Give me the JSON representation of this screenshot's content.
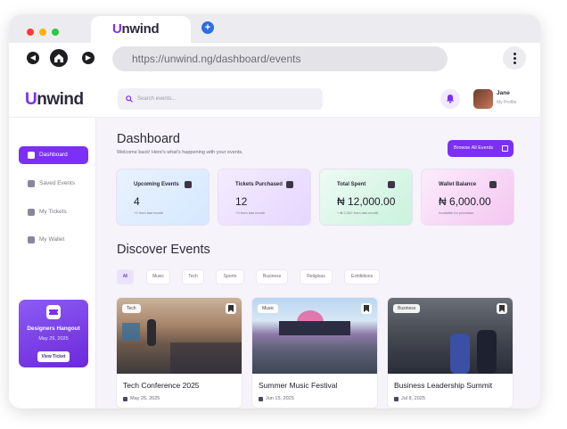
{
  "browser": {
    "tab_logo_u": "U",
    "tab_logo_rest": "nwind",
    "new_tab": "+",
    "url": "https://unwind.ng/dashboard/events"
  },
  "header": {
    "brand_u": "U",
    "brand_rest": "nwind",
    "search_placeholder": "Search events...",
    "user_name": "Jane",
    "user_role": "My Profile"
  },
  "sidebar": {
    "items": [
      {
        "label": "Dashboard",
        "icon": "home-icon"
      },
      {
        "label": "Saved Events",
        "icon": "bookmark-icon"
      },
      {
        "label": "My Tickets",
        "icon": "ticket-icon"
      },
      {
        "label": "My Wallet",
        "icon": "wallet-icon"
      }
    ],
    "promo": {
      "title": "Designers Hangout",
      "date": "May 29, 2025",
      "button": "View Ticket"
    }
  },
  "main": {
    "title": "Dashboard",
    "subtitle": "Welcome back! Here's what's happening with your events.",
    "browse_button": "Browse All Events",
    "stats": [
      {
        "title": "Upcoming Events",
        "value": "4",
        "note": "+2 from last month"
      },
      {
        "title": "Tickets Purchased",
        "value": "12",
        "note": "+3 from last month"
      },
      {
        "title": "Total Spent",
        "value": "₦ 12,000.00",
        "note": "+ ₦ 2,000 from last month"
      },
      {
        "title": "Wallet Balance",
        "value": "₦ 6,000.00",
        "note": "Available for purchase"
      }
    ],
    "discover_title": "Discover Events",
    "filters": [
      "All",
      "Music",
      "Tech",
      "Sports",
      "Business",
      "Religious",
      "Exhibitions"
    ],
    "events": [
      {
        "tag": "Tech",
        "title": "Tech Conference 2025",
        "date": "May 25, 2025"
      },
      {
        "tag": "Music",
        "title": "Summer Music Festival",
        "date": "Jun 15, 2025"
      },
      {
        "tag": "Business",
        "title": "Business Leadership Summit",
        "date": "Jul 8, 2025"
      }
    ]
  },
  "colors": {
    "accent": "#7b2ff7",
    "background": "#f6f4fa"
  }
}
